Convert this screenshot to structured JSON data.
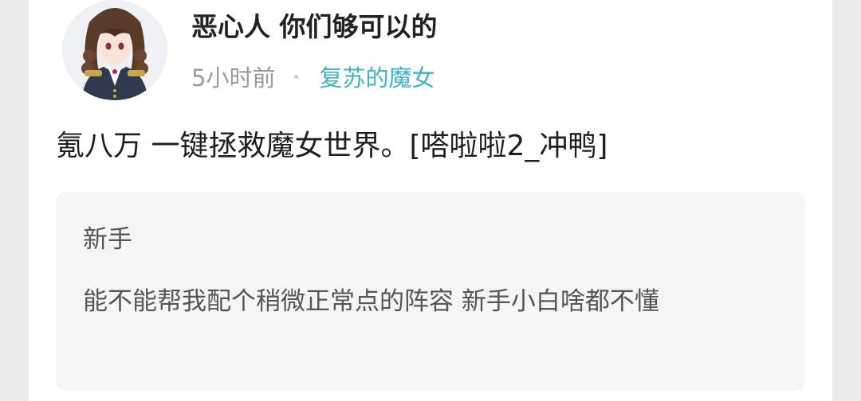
{
  "post": {
    "author": {
      "name": "恶心人 你们够可以的",
      "avatar_icon": "anime-girl-avatar-icon"
    },
    "time": "5小时前",
    "topic": "复苏的魔女",
    "content": "氪八万 一键拯救魔女世界。[嗒啦啦2_冲鸭]"
  },
  "quoted": {
    "title": "新手",
    "body": "能不能帮我配个稍微正常点的阵容 新手小白啥都不懂"
  },
  "colors": {
    "topic": "#3fb3c3",
    "quote_bg": "#f5f5f5",
    "text": "#1f1f1f",
    "meta": "#9a9a9a"
  }
}
